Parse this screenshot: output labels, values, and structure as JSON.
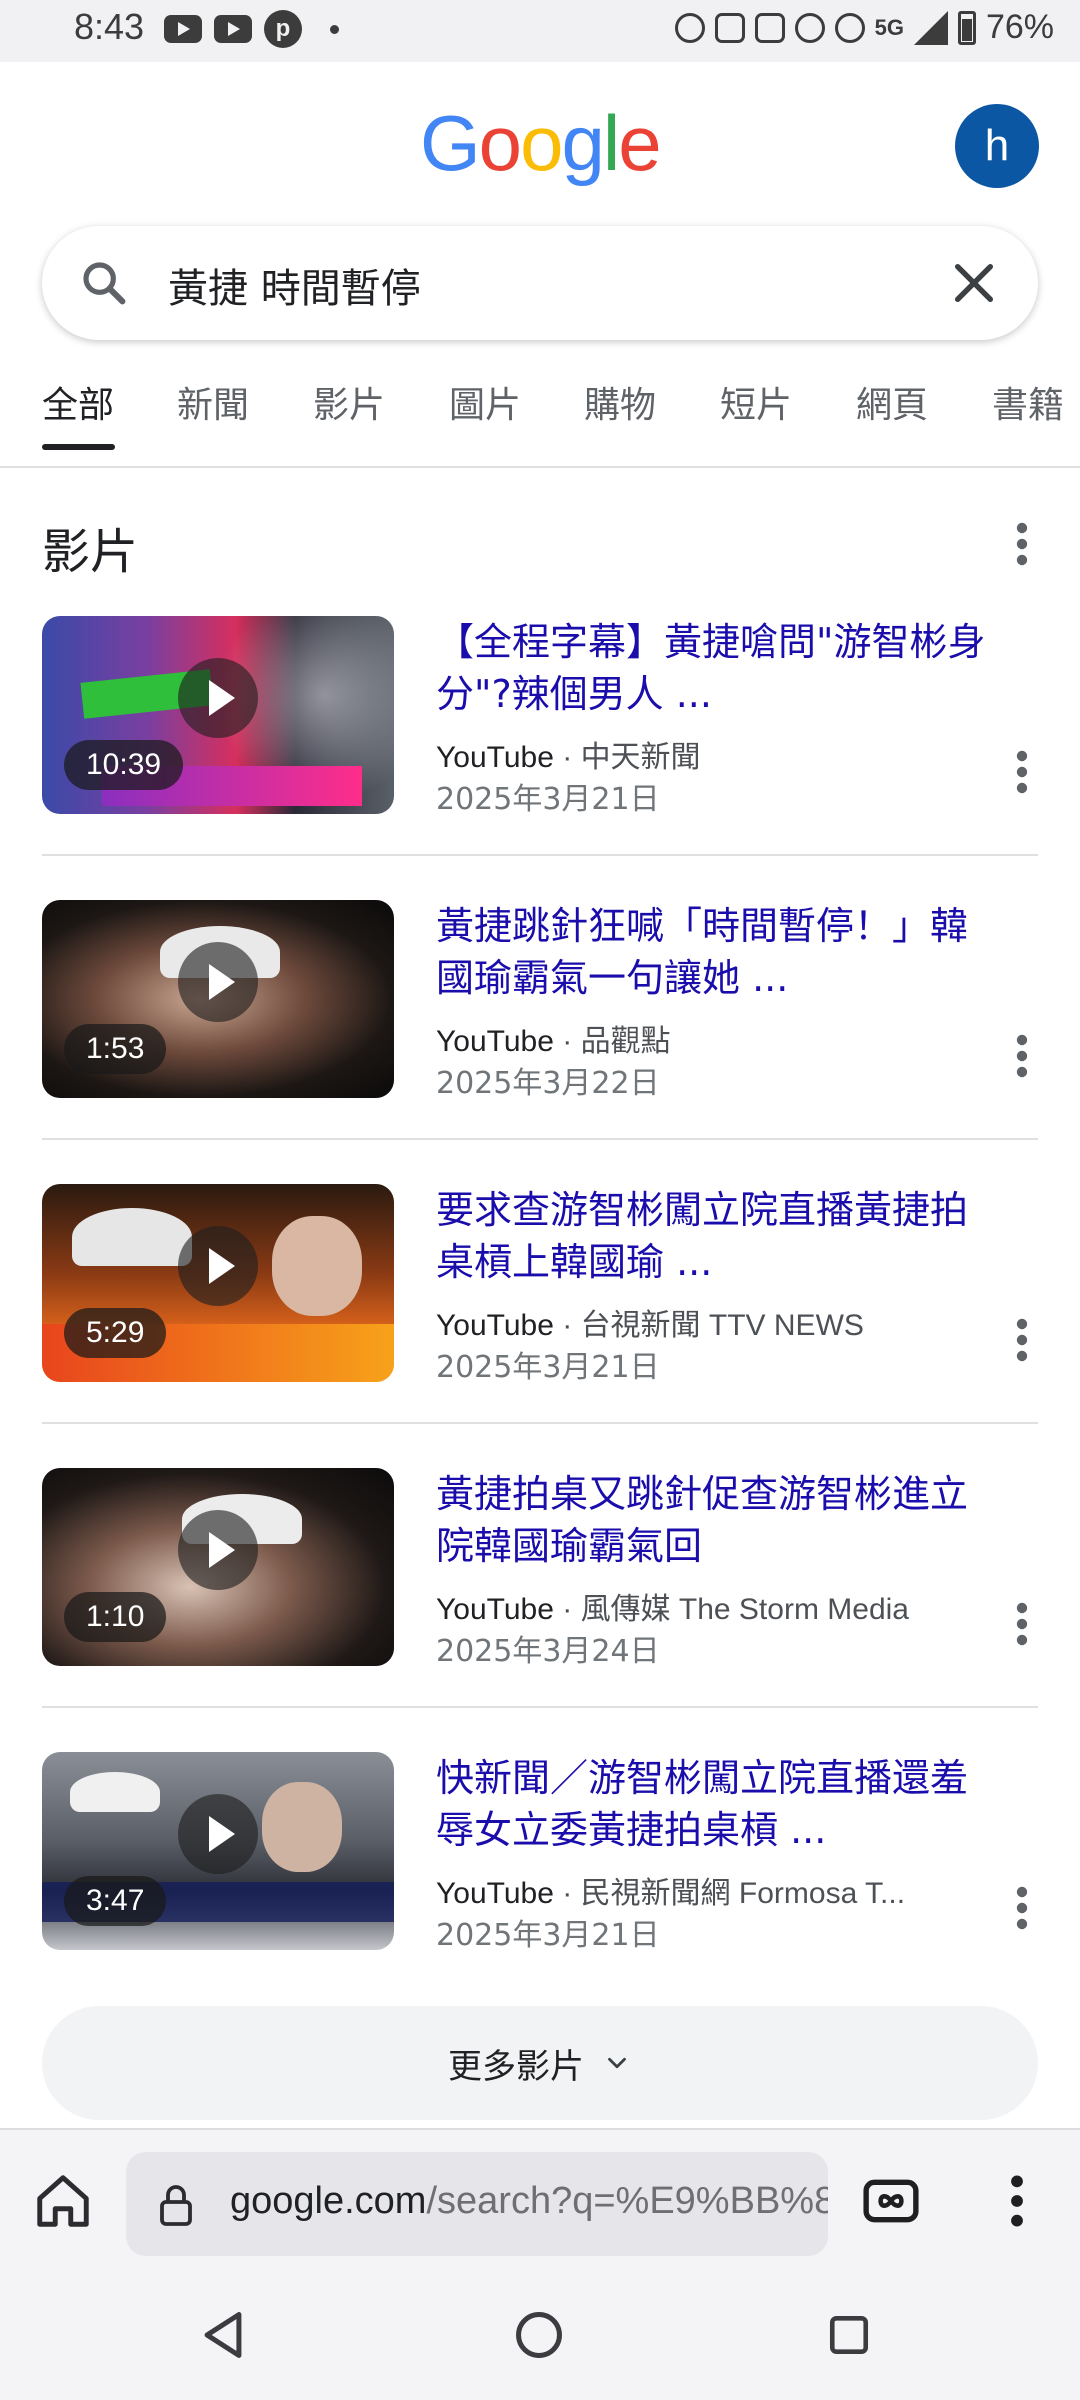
{
  "status_bar": {
    "time": "8:43",
    "battery": "76%",
    "network": "5G"
  },
  "header": {
    "logo_letters": [
      {
        "char": "G",
        "color": "#4285F4"
      },
      {
        "char": "o",
        "color": "#EA4335"
      },
      {
        "char": "o",
        "color": "#FBBC05"
      },
      {
        "char": "g",
        "color": "#4285F4"
      },
      {
        "char": "l",
        "color": "#34A853"
      },
      {
        "char": "e",
        "color": "#EA4335"
      }
    ],
    "avatar_letter": "h",
    "avatar_color": "#0b57a3"
  },
  "search": {
    "query": "黃捷 時間暫停"
  },
  "tabs": [
    {
      "label": "全部",
      "active": true
    },
    {
      "label": "新聞",
      "active": false
    },
    {
      "label": "影片",
      "active": false
    },
    {
      "label": "圖片",
      "active": false
    },
    {
      "label": "購物",
      "active": false
    },
    {
      "label": "短片",
      "active": false
    },
    {
      "label": "網頁",
      "active": false
    },
    {
      "label": "書籍",
      "active": false
    }
  ],
  "section": {
    "title": "影片"
  },
  "results": [
    {
      "title": "【全程字幕】黃捷嗆問\"游智彬身分\"?辣個男人 ...",
      "source": "YouTube",
      "channel": "中天新聞",
      "date": "2025年3月21日",
      "duration": "10:39"
    },
    {
      "title": "黃捷跳針狂喊「時間暫停！」韓國瑜霸氣一句讓她 ...",
      "source": "YouTube",
      "channel": "品觀點",
      "date": "2025年3月22日",
      "duration": "1:53"
    },
    {
      "title": "要求查游智彬闖立院直播黃捷拍桌槓上韓國瑜 ...",
      "source": "YouTube",
      "channel": "台視新聞 TTV NEWS",
      "date": "2025年3月21日",
      "duration": "5:29"
    },
    {
      "title": "黃捷拍桌又跳針促查游智彬進立院韓國瑜霸氣回",
      "source": "YouTube",
      "channel": "風傳媒 The Storm Media",
      "date": "2025年3月24日",
      "duration": "1:10"
    },
    {
      "title": "快新聞／游智彬闖立院直播還羞辱女立委黃捷拍桌槓 ...",
      "source": "YouTube",
      "channel": "民視新聞網 Formosa T...",
      "date": "2025年3月21日",
      "duration": "3:47"
    }
  ],
  "more_button": {
    "label": "更多影片"
  },
  "browser": {
    "url_host": "google.com",
    "url_path": "/search?q=%E9%BB%8"
  },
  "colors": {
    "link": "#1a0dab",
    "tab_active": "#202124",
    "tab_inactive": "#5f6368"
  }
}
